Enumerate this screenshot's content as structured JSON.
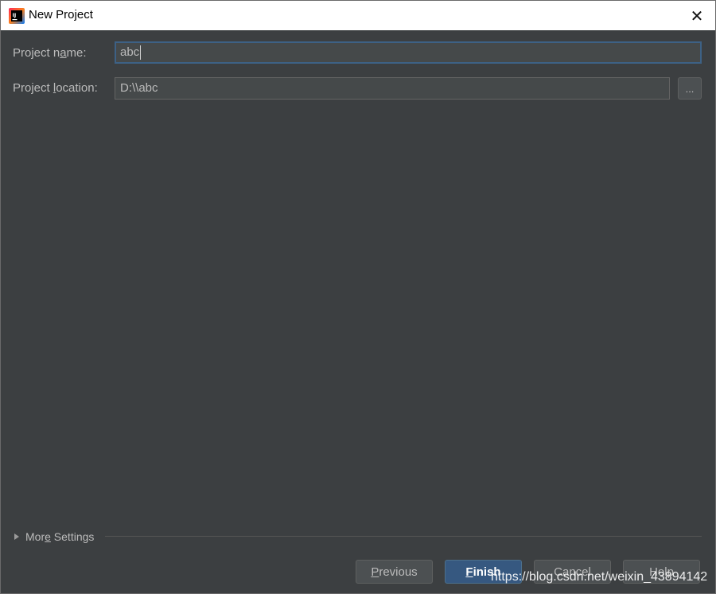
{
  "window": {
    "title": "New Project",
    "close_glyph": "✕",
    "app_icon": "intellij-idea-icon"
  },
  "form": {
    "project_name": {
      "label_pre": "Project n",
      "label_mnemonic": "a",
      "label_post": "me:",
      "value": "abc"
    },
    "project_location": {
      "label_pre": "Project ",
      "label_mnemonic": "l",
      "label_post": "ocation:",
      "value": "D:\\\\abc",
      "browse_label": "..."
    }
  },
  "more_settings": {
    "label_pre": "Mor",
    "label_mnemonic": "e",
    "label_post": " Settings",
    "icon": "triangle-right-icon"
  },
  "buttons": {
    "previous": {
      "mnemonic": "P",
      "rest": "revious"
    },
    "finish": {
      "mnemonic": "F",
      "rest": "inish"
    },
    "cancel": {
      "label": "Cancel"
    },
    "help": {
      "label": "Help"
    }
  },
  "watermark": "https://blog.csdn.net/weixin_43894142",
  "colors": {
    "background": "#3c3f41",
    "input_bg": "#45494a",
    "focus_border": "#3d6185",
    "primary_button": "#365880",
    "text": "#bbbbbb"
  }
}
